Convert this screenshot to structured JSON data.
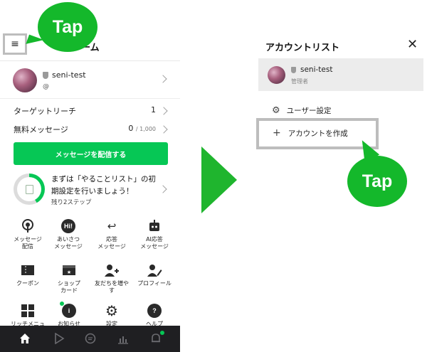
{
  "left": {
    "title_fragment": "ーム",
    "menu_glyph": "≡",
    "tap_label": "Tap",
    "account": {
      "name": "seni-test",
      "handle": "@"
    },
    "stats": [
      {
        "label": "ターゲットリーチ",
        "value": "1",
        "suffix": ""
      },
      {
        "label": "無料メッセージ",
        "value": "0",
        "suffix": "/ 1,000"
      }
    ],
    "send_button": "メッセージを配信する",
    "todo": {
      "title": "まずは「やることリスト」の初期設定を行いましょう！",
      "subtitle": "残り2ステップ",
      "progress": 0.42
    },
    "grid": [
      {
        "label": "メッセージ\n配信",
        "icon": "broadcast-icon"
      },
      {
        "label": "あいさつ\nメッセージ",
        "icon": "greeting-icon",
        "glyph": "Hi!"
      },
      {
        "label": "応答\nメッセージ",
        "icon": "reply-icon",
        "glyph": "↩"
      },
      {
        "label": "AI応答\nメッセージ",
        "icon": "robot-icon",
        "glyph": "🤖"
      },
      {
        "label": "クーポン",
        "icon": "coupon-icon"
      },
      {
        "label": "ショップ\nカード",
        "icon": "shop-card-icon"
      },
      {
        "label": "友だちを増や\nす",
        "icon": "add-friend-icon",
        "glyph": "👤"
      },
      {
        "label": "プロフィール",
        "icon": "profile-icon",
        "glyph": "👤"
      },
      {
        "label": "リッチメニュ",
        "icon": "rich-menu-icon",
        "glyph": "▦"
      },
      {
        "label": "お知らせ",
        "icon": "info-icon",
        "glyph": "i"
      },
      {
        "label": "設定",
        "icon": "settings-icon",
        "glyph": "⚙"
      },
      {
        "label": "ヘルプ",
        "icon": "help-icon",
        "glyph": "?"
      }
    ],
    "nav": [
      {
        "icon": "home-icon",
        "glyph": "⌂"
      },
      {
        "icon": "play-icon",
        "glyph": "▷"
      },
      {
        "icon": "chat-icon",
        "glyph": "◯"
      },
      {
        "icon": "stats-icon",
        "glyph": "▥"
      },
      {
        "icon": "bell-icon",
        "glyph": "🔔"
      }
    ]
  },
  "right": {
    "title": "アカウントリスト",
    "close_glyph": "✕",
    "account": {
      "name": "seni-test",
      "role": "管理者"
    },
    "user_settings": "ユーザー設定",
    "create_account": "アカウントを作成",
    "tap_label": "Tap"
  },
  "colors": {
    "line_green": "#06c755",
    "tap_green": "#14b82b",
    "arrow_green": "#1fb52e",
    "nav_dark": "#1f1f22"
  }
}
